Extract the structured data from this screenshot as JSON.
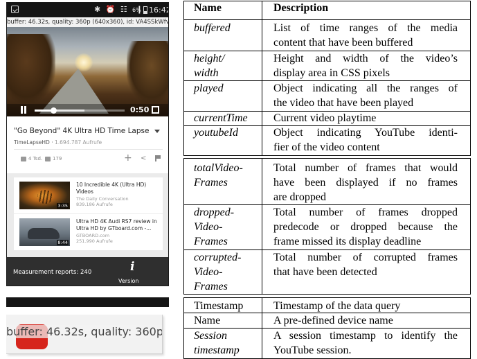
{
  "phone": {
    "status_bar": {
      "icons": "✱ ⏰ ☷ .❙",
      "battery": "6%",
      "time": "16:42"
    },
    "debug_line": "buffer: 46.32s, quality: 360p (640x360), id: VA4SSkWfv24",
    "player": {
      "time": "0:50",
      "played_fraction": 0.21,
      "buffered_fraction": 0.55
    },
    "video": {
      "title": "\"Go Beyond\" 4K Ultra HD Time Lapse",
      "channel": "TimeLapseHD",
      "views": "1.694.787 Aufrufe",
      "likes": "4 Tsd.",
      "dislikes": "179"
    },
    "suggestions": [
      {
        "title": "10 Incredible 4K (Ultra HD) Videos",
        "channel": "The Daily Conversation",
        "views": "839.186 Aufrufe",
        "duration": "3:35"
      },
      {
        "title": "Ultra HD 4K Audi RS7 review in Ultra HD by GTboard.com -...",
        "channel": "GTBOARD.com",
        "views": "251.990 Aufrufe",
        "duration": "8:44"
      }
    ],
    "overlay": {
      "reports": "Measurement reports: 240",
      "version_label": "Version",
      "info_glyph": "i"
    },
    "zoom_text": "buffer: 46.32s, quality: 360p"
  },
  "table": {
    "header_name": "Name",
    "header_description": "Description",
    "rows": [
      {
        "name": [
          "buffered"
        ],
        "description": [
          "List of time ranges of the media",
          "content that have been buffered"
        ]
      },
      {
        "name": [
          "height/",
          "width"
        ],
        "description": [
          "Height and width of the video’s",
          "display area in CSS pixels"
        ]
      },
      {
        "name": [
          "played"
        ],
        "description": [
          "Object indicating all the ranges of",
          "the video that have been played"
        ]
      },
      {
        "name": [
          "currentTime"
        ],
        "description": [
          "Current video playtime"
        ]
      },
      {
        "name": [
          "youtubeId"
        ],
        "description": [
          "Object indicating YouTube identi-",
          "fier of the video content"
        ]
      },
      {
        "name": [
          "totalVideo-",
          "Frames"
        ],
        "description": [
          "Total number of frames that would",
          "have been displayed if no frames",
          "are dropped"
        ]
      },
      {
        "name": [
          "dropped-",
          "Video-",
          "Frames"
        ],
        "description": [
          "Total number of frames dropped",
          "predecode or dropped because the",
          "frame missed its display deadline"
        ]
      },
      {
        "name": [
          "corrupted-",
          "Video-",
          "Frames"
        ],
        "description": [
          "Total number of corrupted frames",
          "that have been detected"
        ]
      },
      {
        "name": [
          "Timestamp"
        ],
        "description": [
          "Timestamp of the data query"
        ]
      },
      {
        "name": [
          "Name"
        ],
        "description": [
          "A pre-defined device name"
        ]
      },
      {
        "name": [
          "Session",
          "timestamp"
        ],
        "description": [
          "A session timestamp to identify the",
          "YouTube session."
        ]
      }
    ]
  }
}
